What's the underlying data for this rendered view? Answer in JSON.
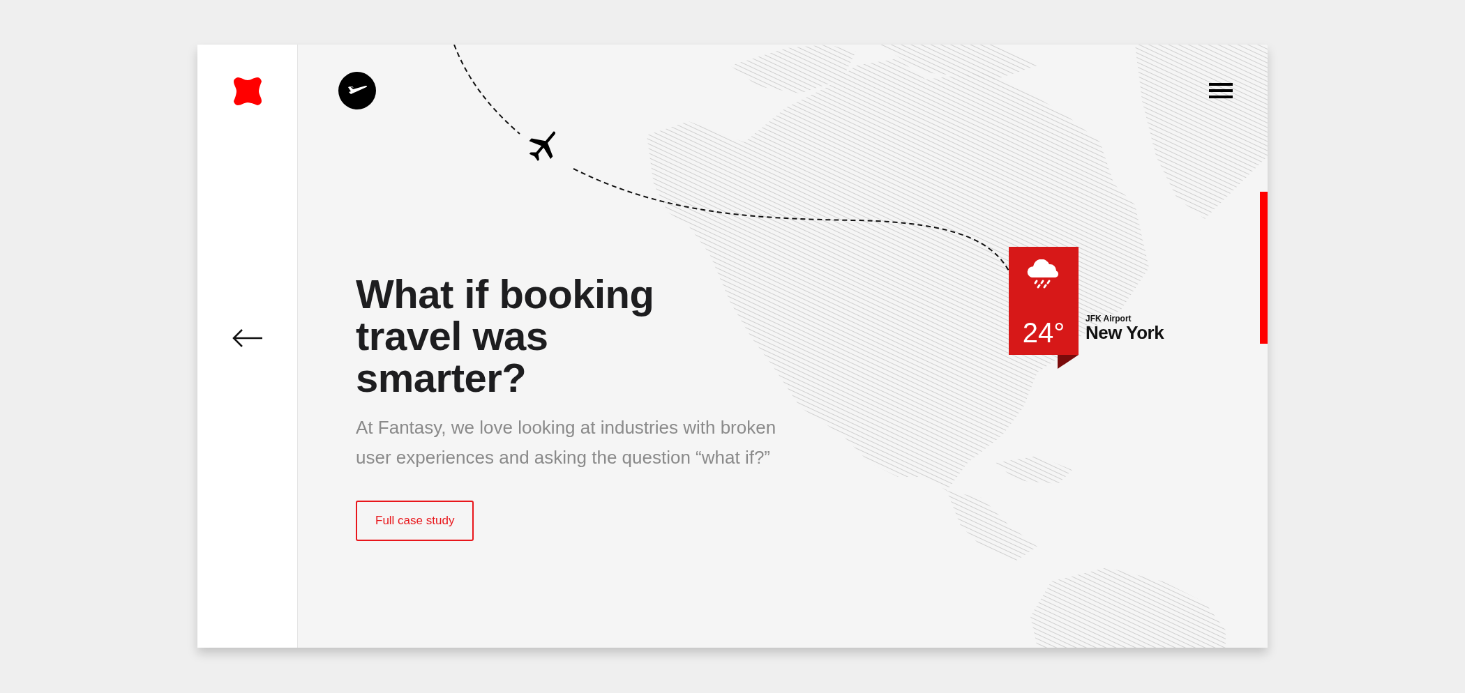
{
  "hero": {
    "heading": "What if booking travel was smarter?",
    "description": "At Fantasy, we love looking at industries with broken user experiences and asking the question “what if?”",
    "button": "Full case study"
  },
  "weather_pin": {
    "temperature": "24°",
    "airport": "JFK Airport",
    "city": "New York"
  }
}
